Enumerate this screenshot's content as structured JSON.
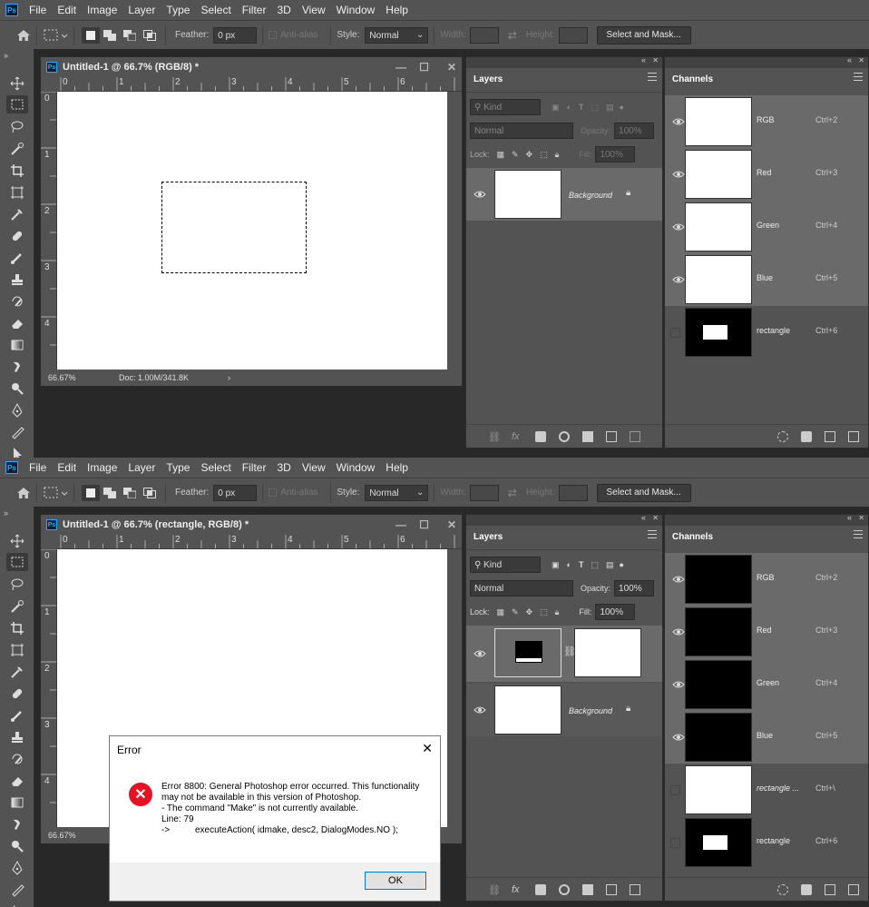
{
  "menu": [
    "File",
    "Edit",
    "Image",
    "Layer",
    "Type",
    "Select",
    "Filter",
    "3D",
    "View",
    "Window",
    "Help"
  ],
  "app_logo": "Ps",
  "options": {
    "feather_label": "Feather:",
    "feather_value": "0 px",
    "antialias_label": "Anti-alias",
    "style_label": "Style:",
    "style_value": "Normal",
    "width_label": "Width:",
    "height_label": "Height:",
    "select_mask_label": "Select and Mask..."
  },
  "top": {
    "doc_title": "Untitled-1 @ 66.7% (RGB/8) *",
    "zoom": "66.67%",
    "doc_info": "Doc: 1.00M/341.8K",
    "layers_tab": "Layers",
    "channels_tab": "Channels",
    "kind_label": "Kind",
    "blend_mode": "Normal",
    "opacity_label": "Opacity:",
    "opacity_value": "100%",
    "lock_label": "Lock:",
    "fill_label": "Fill:",
    "fill_value": "100%",
    "layers": [
      {
        "name": "Background"
      }
    ],
    "channels": [
      {
        "name": "RGB",
        "key": "Ctrl+2"
      },
      {
        "name": "Red",
        "key": "Ctrl+3"
      },
      {
        "name": "Green",
        "key": "Ctrl+4"
      },
      {
        "name": "Blue",
        "key": "Ctrl+5"
      },
      {
        "name": "rectangle",
        "key": "Ctrl+6"
      }
    ]
  },
  "bottom": {
    "doc_title": "Untitled-1 @ 66.7% (rectangle, RGB/8) *",
    "zoom": "66.67%",
    "layers_tab": "Layers",
    "channels_tab": "Channels",
    "kind_label": "Kind",
    "blend_mode": "Normal",
    "opacity_label": "Opacity:",
    "opacity_value": "100%",
    "lock_label": "Lock:",
    "fill_label": "Fill:",
    "fill_value": "100%",
    "layers": [
      {
        "name": "Background"
      }
    ],
    "channels": [
      {
        "name": "RGB",
        "key": "Ctrl+2"
      },
      {
        "name": "Red",
        "key": "Ctrl+3"
      },
      {
        "name": "Green",
        "key": "Ctrl+4"
      },
      {
        "name": "Blue",
        "key": "Ctrl+5"
      },
      {
        "name": "rectangle ...",
        "key": "Ctrl+\\"
      },
      {
        "name": "rectangle",
        "key": "Ctrl+6"
      }
    ]
  },
  "ruler_numbers_h": [
    "0",
    "1",
    "2",
    "3",
    "4",
    "5",
    "6"
  ],
  "ruler_numbers_v": [
    "0",
    "1",
    "2",
    "3",
    "4"
  ],
  "dialog": {
    "title": "Error",
    "message": "Error 8800: General Photoshop error occurred. This functionality may not be available in this version of Photoshop.\n- The command \"Make\" is not currently available.\nLine: 79\n->          executeAction( idmake, desc2, DialogModes.NO );",
    "ok_label": "OK"
  },
  "colors": {
    "ui_bg": "#535353",
    "accent": "#31a8ff",
    "error_red": "#e81123"
  }
}
